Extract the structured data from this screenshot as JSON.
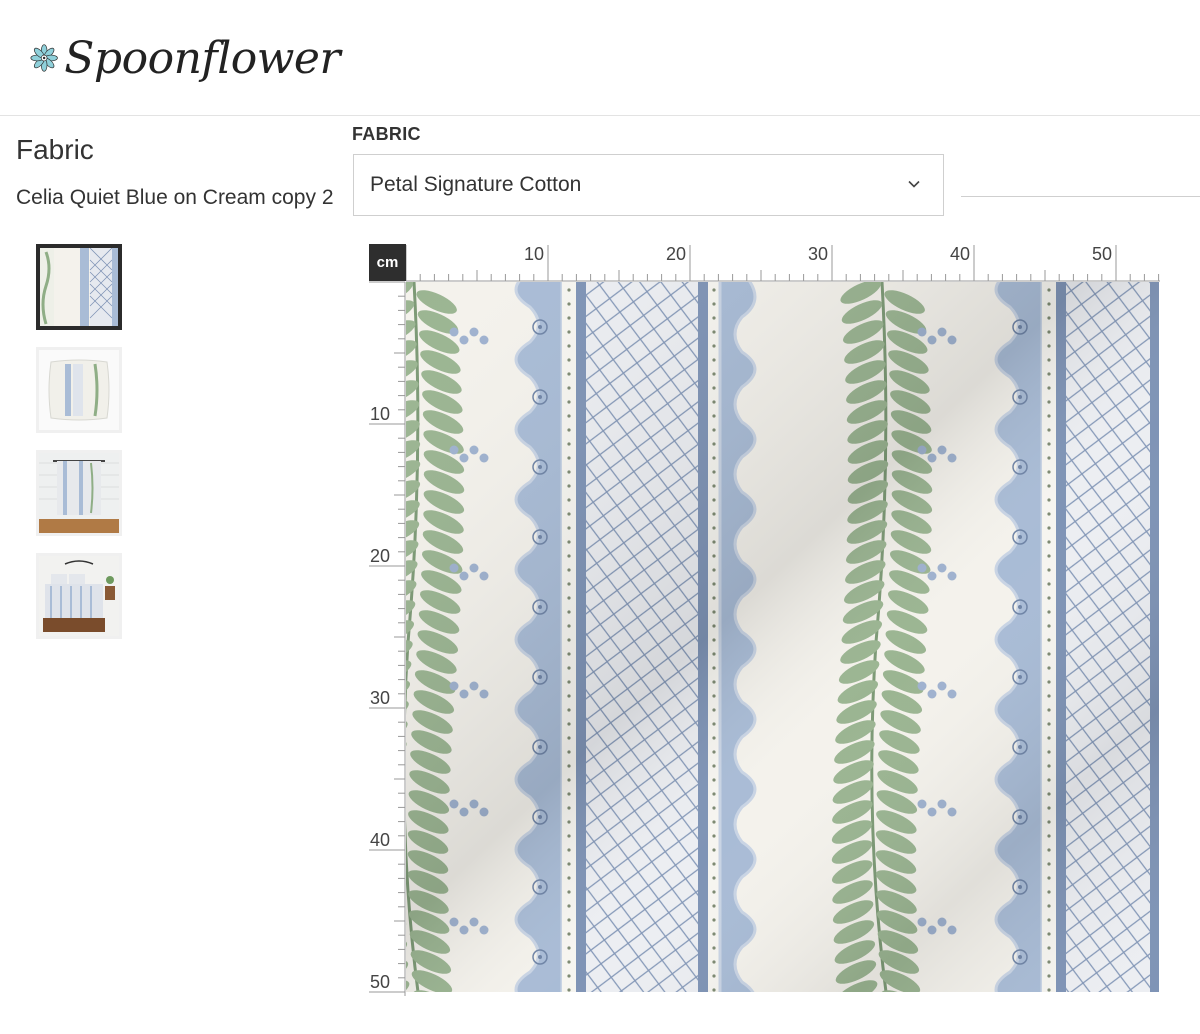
{
  "brand": {
    "name": "Spoonflower",
    "accent": "#6bb8c8"
  },
  "product": {
    "type": "Fabric",
    "design_name": "Celia Quiet Blue on Cream copy 2"
  },
  "fabric_selector": {
    "label": "FABRIC",
    "selected": "Petal Signature Cotton"
  },
  "thumbnails": [
    {
      "name": "swatch",
      "selected": true
    },
    {
      "name": "pillow",
      "selected": false
    },
    {
      "name": "blanket",
      "selected": false
    },
    {
      "name": "bedding",
      "selected": false
    }
  ],
  "ruler": {
    "unit_label": "cm",
    "top_ticks": [
      "10",
      "20",
      "30",
      "40",
      "50"
    ],
    "left_ticks": [
      "10",
      "20",
      "30",
      "40",
      "50"
    ]
  },
  "colors": {
    "cream": "#f4f2ec",
    "blue": "#a9bcd6",
    "blue_dark": "#7f94b6",
    "green": "#9bb592",
    "green_dark": "#7d9a76"
  }
}
